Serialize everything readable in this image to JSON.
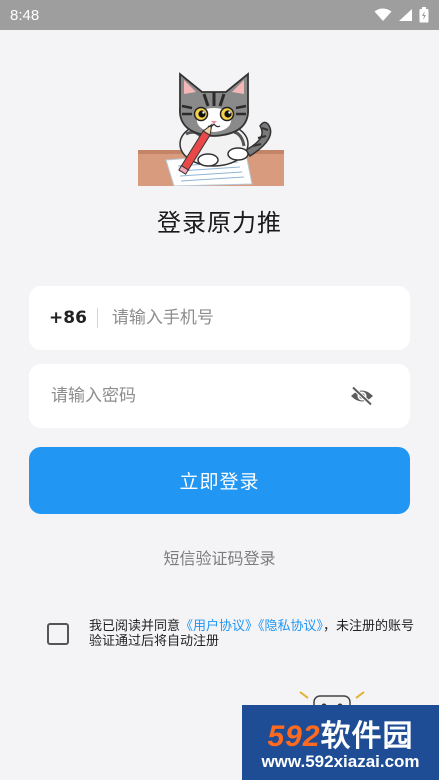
{
  "status_bar": {
    "time": "8:48"
  },
  "page": {
    "title": "登录原力推"
  },
  "phone": {
    "country_code": "+86",
    "placeholder": "请输入手机号"
  },
  "password": {
    "placeholder": "请输入密码"
  },
  "login_button": {
    "label": "立即登录"
  },
  "sms_login": {
    "label": "短信验证码登录"
  },
  "agreement": {
    "prefix": "我已阅读并同意",
    "user_agreement": "《用户协议》",
    "privacy_agreement": "《隐私协议》",
    "suffix": "，未注册的账号验证通过后将自动注册",
    "checked": false
  },
  "watermark": {
    "brand_num": "592",
    "brand_text": "软件园",
    "url": "www.592xiazai.com"
  },
  "colors": {
    "primary": "#2196f3",
    "background": "#f4f4f6",
    "status_bar": "#9e9e9e",
    "watermark_bg": "#1e4d95"
  },
  "icons": [
    "wifi-icon",
    "signal-icon",
    "battery-icon",
    "eye-off-icon",
    "cat-illustration"
  ]
}
